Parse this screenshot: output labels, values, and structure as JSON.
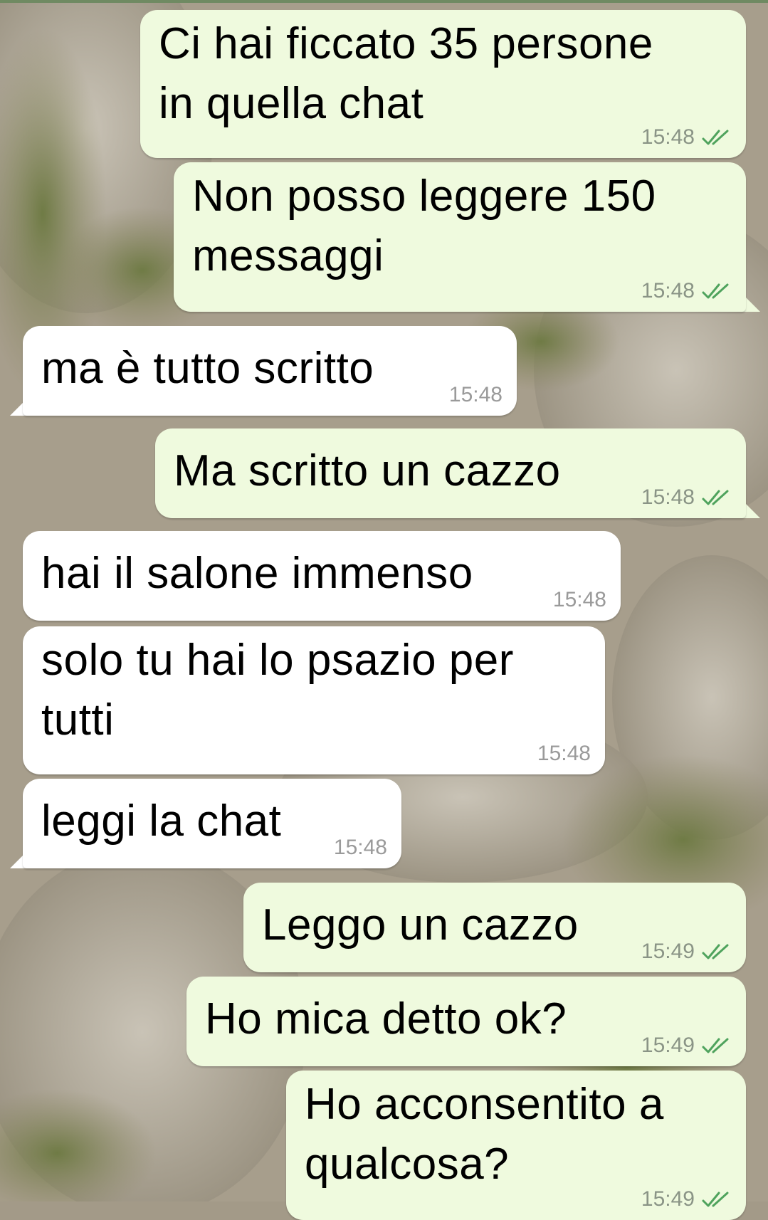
{
  "theme": {
    "sent_bubble": "#effade",
    "received_bubble": "#ffffff",
    "read_check": "#4fa35d"
  },
  "messages": [
    {
      "text": "Ci hai ficcato 35 persone\nin quella chat",
      "time": "15:48",
      "status": "read-double-check-icon"
    },
    {
      "text": "Non posso leggere 150\nmessaggi",
      "time": "15:48",
      "status": "read-double-check-icon"
    },
    {
      "text": "ma è tutto scritto",
      "time": "15:48"
    },
    {
      "text": "Ma scritto un cazzo",
      "time": "15:48",
      "status": "read-double-check-icon"
    },
    {
      "text": "hai il salone immenso",
      "time": "15:48"
    },
    {
      "text": "solo tu hai lo psazio per\ntutti",
      "time": "15:48"
    },
    {
      "text": "leggi la chat",
      "time": "15:48"
    },
    {
      "text": "Leggo un cazzo",
      "time": "15:49",
      "status": "read-double-check-icon"
    },
    {
      "text": "Ho mica detto ok?",
      "time": "15:49",
      "status": "read-double-check-icon"
    },
    {
      "text": "Ho acconsentito a\nqualcosa?",
      "time": "15:49",
      "status": "read-double-check-icon"
    }
  ]
}
